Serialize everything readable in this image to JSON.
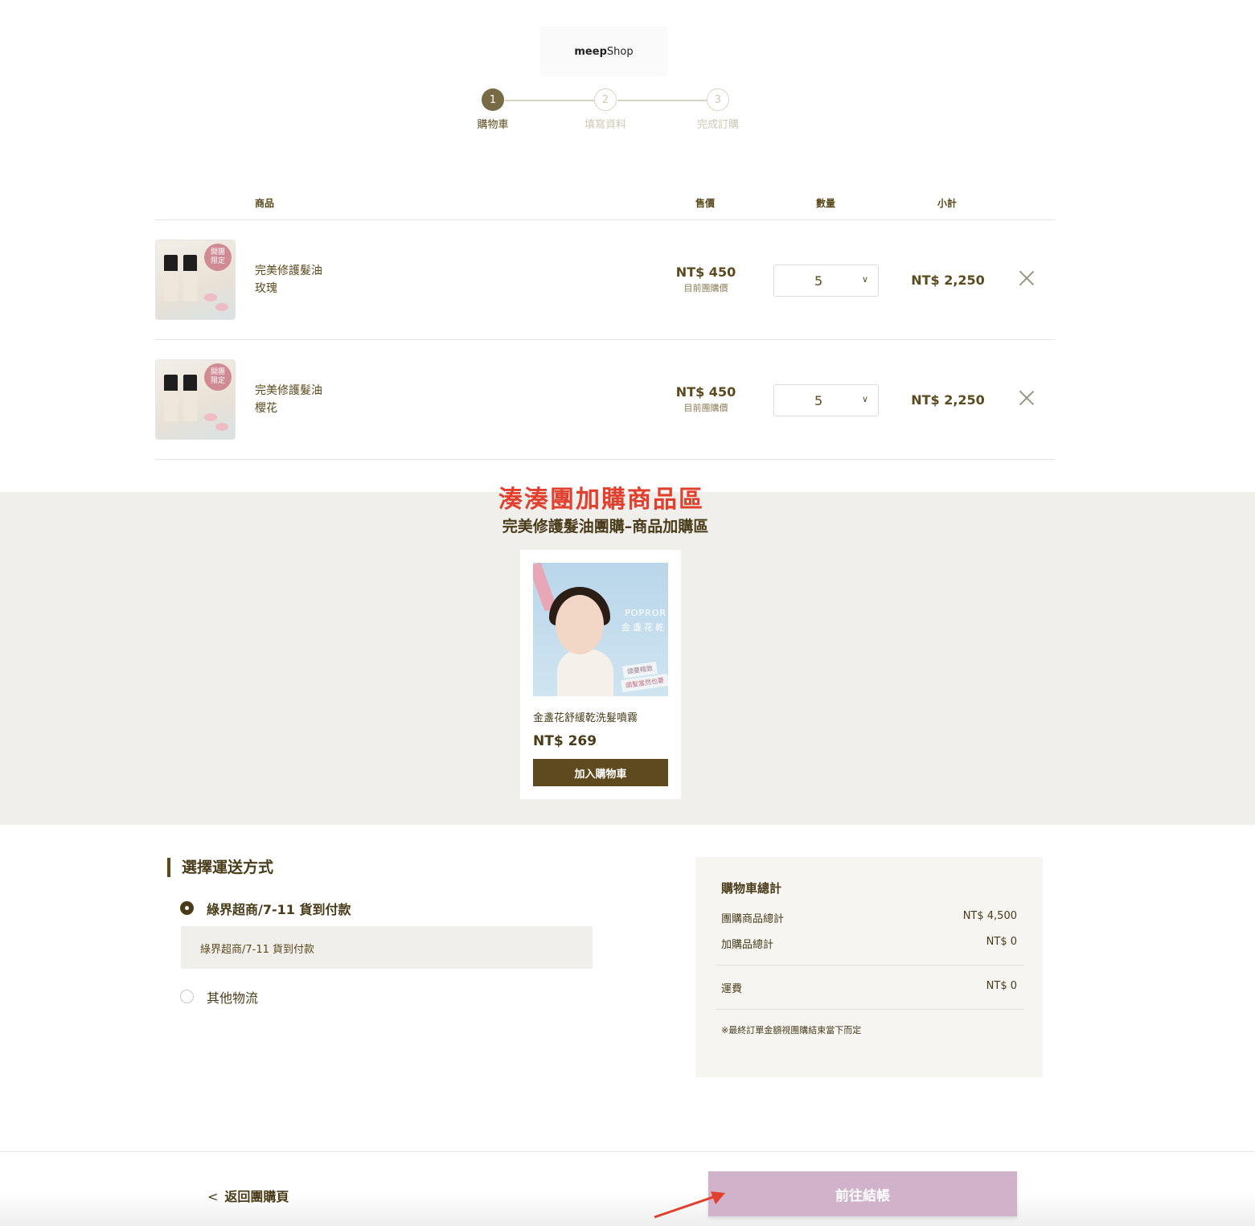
{
  "brand": {
    "logo_bold": "meep",
    "logo_regular": "Shop"
  },
  "steps": [
    {
      "number": "1",
      "label": "購物車",
      "active": true
    },
    {
      "number": "2",
      "label": "填寫資料",
      "active": false
    },
    {
      "number": "3",
      "label": "完成訂購",
      "active": false
    }
  ],
  "cart": {
    "headers": {
      "product": "商品",
      "price": "售價",
      "quantity": "數量",
      "subtotal": "小計"
    },
    "items": [
      {
        "name": "完美修護髮油",
        "variant": "玫瑰",
        "badge": "開團\n限定",
        "price": "NT$ 450",
        "price_note": "目前團購價",
        "quantity": "5",
        "subtotal": "NT$ 2,250"
      },
      {
        "name": "完美修護髮油",
        "variant": "櫻花",
        "badge": "開團\n限定",
        "price": "NT$ 450",
        "price_note": "目前團購價",
        "quantity": "5",
        "subtotal": "NT$ 2,250"
      }
    ]
  },
  "addon": {
    "annotation": "湊湊團加購商品區",
    "title": "完美修護髮油團購–商品加購區",
    "product": {
      "name": "金盞花舒緩乾洗髮噴霧",
      "price": "NT$ 269",
      "button": "加入購物車",
      "image_text": {
        "brand": "POPROR",
        "line": "金盞花乾",
        "tag1": "頭要精致",
        "tag2": "頭髮當然也要"
      }
    }
  },
  "shipping": {
    "title": "選擇運送方式",
    "options": [
      {
        "label": "綠界超商/7-11 貨到付款",
        "selected": true
      },
      {
        "label": "其他物流",
        "selected": false
      }
    ],
    "selected_detail": "綠界超商/7-11 貨到付款"
  },
  "summary": {
    "title": "購物車總計",
    "group_total_label": "團購商品總計",
    "group_total_value": "NT$ 4,500",
    "addon_total_label": "加購品總計",
    "addon_total_value": "NT$ 0",
    "shipping_label": "運費",
    "shipping_value": "NT$ 0",
    "note": "※最終訂單金額視團購結束當下而定"
  },
  "footer": {
    "back_label": "返回團購頁",
    "checkout_label": "前往結帳"
  },
  "colors": {
    "brand_brown": "#5e4a1e",
    "checkout_pink": "#d0b3ca",
    "annotation_red": "#e2402e",
    "section_bg": "#f1efeb"
  }
}
